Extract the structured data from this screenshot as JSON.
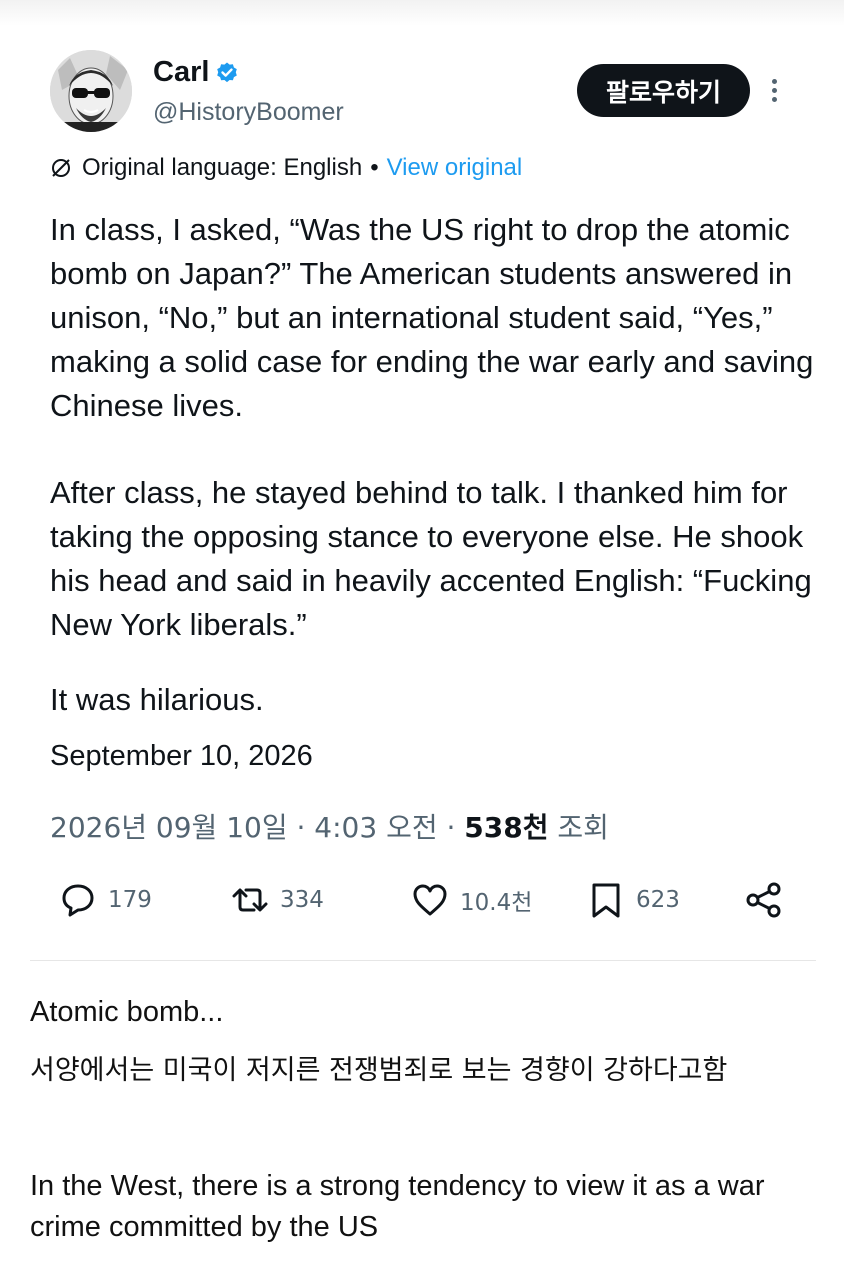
{
  "tweet": {
    "author_name": "Carl",
    "author_handle": "@HistoryBoomer",
    "follow_label": "팔로우하기",
    "translation_label": "Original language: English",
    "view_original_label": "View original",
    "dot_separator": "•",
    "paragraphs": [
      "In class, I asked, “Was the US right to drop the atomic bomb on Japan?” The American students answered in unison, “No,” but an international student said, “Yes,” making a solid case for ending the war early and saving Chinese lives.",
      "After class, he stayed behind to talk. I thanked him for taking the opposing stance to everyone else. He shook his head and said in heavily accented English: “Fucking New York liberals.”",
      "It was hilarious."
    ],
    "date_text": "September 10, 2026",
    "timestamp": "2026년 09월 10일 · 4:03 오전 · ",
    "views_count": "538천",
    "views_label": " 조회",
    "stats": {
      "replies": "179",
      "reposts": "334",
      "likes": "10.4천",
      "bookmarks": "623"
    },
    "icons": [
      "verified-badge-icon",
      "no-translate-icon",
      "reply-icon",
      "repost-icon",
      "like-icon",
      "bookmark-icon",
      "share-icon",
      "more-options-icon"
    ],
    "accent_color": "#1d9bf0"
  },
  "caption": {
    "title": "Atomic bomb...",
    "korean_line": "서양에서는 미국이 저지른 전쟁범죄로 보는 경향이 강하다고함",
    "english_line": "In the West, there is a strong tendency to view it as a war crime committed by the US"
  }
}
